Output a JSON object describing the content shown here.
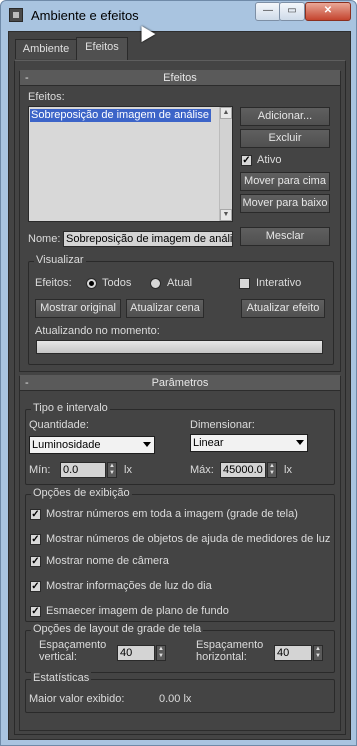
{
  "window": {
    "title": "Ambiente e efeitos",
    "minimize": "—",
    "maximize": "▭",
    "close": "✕"
  },
  "tabs": [
    {
      "label": "Ambiente"
    },
    {
      "label": "Efeitos"
    }
  ],
  "efeitos": {
    "header": "Efeitos",
    "collapse": "-",
    "list_label": "Efeitos:",
    "list_items": [
      "Sobreposição de imagem de análise de"
    ],
    "buttons": {
      "adicionar": "Adicionar...",
      "excluir": "Excluir",
      "mover_cima": "Mover para cima",
      "mover_baixo": "Mover para baixo",
      "mesclar": "Mesclar"
    },
    "ativo": {
      "label": "Ativo",
      "checked": true
    },
    "nome_label": "Nome:",
    "nome_value": "Sobreposição de imagem de anális",
    "visualizar": {
      "title": "Visualizar",
      "efeitos_label": "Efeitos:",
      "radio_todos": "Todos",
      "radio_atual": "Atual",
      "selected": "Todos",
      "interativo": {
        "label": "Interativo",
        "checked": false
      },
      "mostrar_original": "Mostrar original",
      "atualizar_cena": "Atualizar cena",
      "atualizar_efeito": "Atualizar efeito",
      "atualizando_label": "Atualizando no momento:",
      "progress": 0
    }
  },
  "parametros": {
    "header": "Parâmetros",
    "collapse": "-",
    "tipo": {
      "title": "Tipo e intervalo",
      "quantidade_label": "Quantidade:",
      "quantidade_value": "Luminosidade",
      "dimensionar_label": "Dimensionar:",
      "dimensionar_value": "Linear",
      "min_label": "Mín:",
      "min_value": "0.0",
      "min_unit": "lx",
      "max_label": "Máx:",
      "max_value": "45000.0",
      "max_unit": "lx"
    },
    "exibicao": {
      "title": "Opções de exibição",
      "options": [
        {
          "label": "Mostrar números em toda a imagem (grade de tela)",
          "checked": true
        },
        {
          "label": "Mostrar números de objetos de ajuda de medidores de luz",
          "checked": true
        },
        {
          "label": "Mostrar nome de câmera",
          "checked": true
        },
        {
          "label": "Mostrar informações de luz do dia",
          "checked": true
        },
        {
          "label": "Esmaecer imagem de plano de fundo",
          "checked": true
        }
      ]
    },
    "grade": {
      "title": "Opções de layout de grade de tela",
      "vertical_label_1": "Espaçamento",
      "vertical_label_2": "vertical:",
      "vertical_value": "40",
      "horizontal_label_1": "Espaçamento",
      "horizontal_label_2": "horizontal:",
      "horizontal_value": "40"
    },
    "estatisticas": {
      "title": "Estatísticas",
      "maior_label": "Maior valor exibido:",
      "maior_value": "0.00 lx"
    }
  }
}
